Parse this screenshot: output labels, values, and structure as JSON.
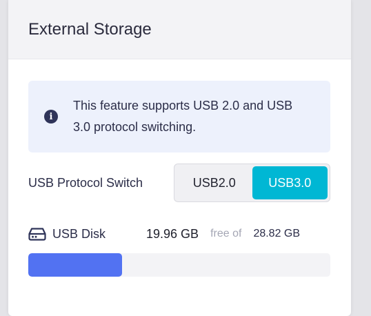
{
  "panel": {
    "title": "External Storage"
  },
  "info": {
    "icon": "info-icon",
    "text": "This feature supports USB 2.0 and USB 3.0 protocol switching."
  },
  "protocol_switch": {
    "label": "USB Protocol Switch",
    "options": [
      "USB2.0",
      "USB3.0"
    ],
    "selected": "USB3.0",
    "accent_color": "#00b7d4"
  },
  "disk": {
    "icon": "hard-drive-icon",
    "label": "USB Disk",
    "used": "19.96 GB",
    "free_of_label": "free of",
    "total": "28.82 GB",
    "usage_fraction": 0.31,
    "bar_color": "#5272f2"
  }
}
